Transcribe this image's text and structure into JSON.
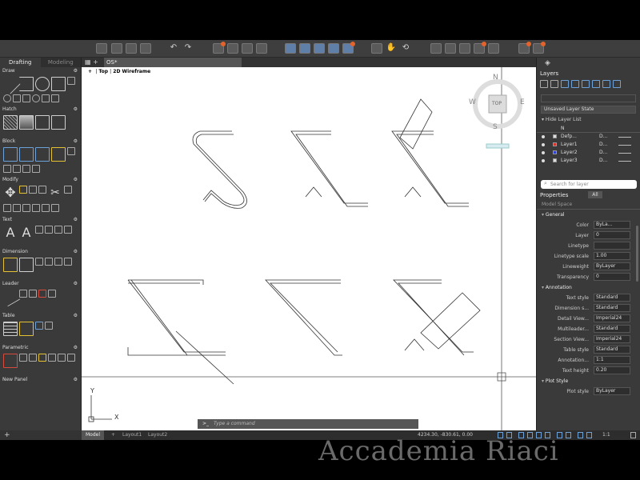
{
  "workspace_tabs": {
    "drafting": "Drafting",
    "modeling": "Modeling"
  },
  "document_tab": "OS*",
  "viewport": {
    "view": "Top",
    "style": "2D Wireframe",
    "sep": "|"
  },
  "left_panels": [
    {
      "key": "draw",
      "label": "Draw"
    },
    {
      "key": "hatch",
      "label": "Hatch"
    },
    {
      "key": "block",
      "label": "Block"
    },
    {
      "key": "modify",
      "label": "Modify"
    },
    {
      "key": "text",
      "label": "Text"
    },
    {
      "key": "dimension",
      "label": "Dimension"
    },
    {
      "key": "leader",
      "label": "Leader"
    },
    {
      "key": "table",
      "label": "Table"
    },
    {
      "key": "parametric",
      "label": "Parametric"
    },
    {
      "key": "newpanel",
      "label": "New Panel"
    }
  ],
  "left_footer": "+",
  "viewcube": {
    "top": "TOP",
    "n": "N",
    "s": "S",
    "e": "E",
    "w": "W"
  },
  "ucs": {
    "x": "X",
    "y": "Y"
  },
  "command_line": {
    "prompt": ">_",
    "placeholder": "Type a command"
  },
  "layout_tabs": {
    "model": "Model",
    "plus": "+",
    "layout1": "Layout1",
    "layout2": "Layout2"
  },
  "coordinates": "4234.30, -830.61, 0.00",
  "scale": "1:1",
  "right_panel": {
    "layers_title": "Layers",
    "layer_state": "Unsaved Layer State",
    "hide_layer_list": "Hide Layer List",
    "layer_header": "N",
    "layers": [
      {
        "name": "Defp...",
        "lw": "D...",
        "color": "#dddddd"
      },
      {
        "name": "Layer1",
        "lw": "D...",
        "color": "#d9312b"
      },
      {
        "name": "Layer2",
        "lw": "D...",
        "color": "#2b3fd9"
      },
      {
        "name": "Layer3",
        "lw": "D...",
        "color": "#dddddd"
      }
    ],
    "search_placeholder": "Search for layer",
    "properties_title": "Properties",
    "all_label": "All",
    "model_space": "Model Space",
    "groups": {
      "general": "General",
      "annotation": "Annotation",
      "plot_style": "Plot Style"
    },
    "general_props": [
      {
        "k": "Color",
        "v": "ByLa..."
      },
      {
        "k": "Layer",
        "v": "0"
      },
      {
        "k": "Linetype",
        "v": ""
      },
      {
        "k": "Linetype scale",
        "v": "1.00"
      },
      {
        "k": "Lineweight",
        "v": "ByLayer"
      },
      {
        "k": "Transparency",
        "v": "0"
      }
    ],
    "annotation_props": [
      {
        "k": "Text style",
        "v": "Standard"
      },
      {
        "k": "Dimension s...",
        "v": "Standard"
      },
      {
        "k": "Detail View...",
        "v": "Imperial24"
      },
      {
        "k": "Multileader...",
        "v": "Standard"
      },
      {
        "k": "Section View...",
        "v": "Imperial24"
      },
      {
        "k": "Table style",
        "v": "Standard"
      },
      {
        "k": "Annotation...",
        "v": "1:1"
      },
      {
        "k": "Text height",
        "v": "0.20"
      }
    ],
    "plot_props": [
      {
        "k": "Plot style",
        "v": "ByLayer"
      }
    ]
  },
  "watermark": "Accademia Riaci"
}
